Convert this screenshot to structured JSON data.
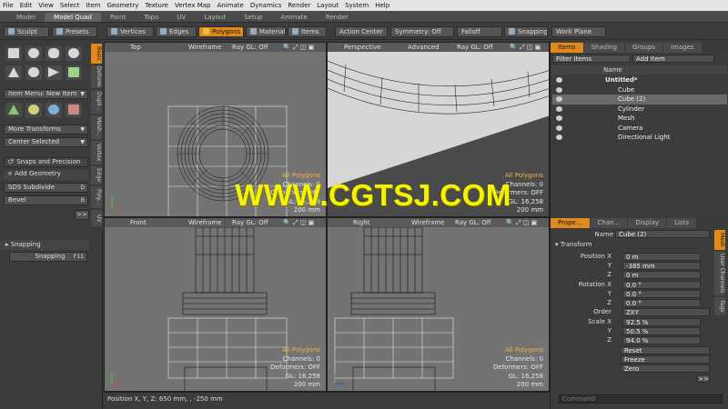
{
  "menu": [
    "File",
    "Edit",
    "View",
    "Select",
    "Item",
    "Geometry",
    "Texture",
    "Vertex Map",
    "Animate",
    "Dynamics",
    "Render",
    "Layout",
    "System",
    "Help"
  ],
  "layout_tabs": [
    {
      "label": "Model"
    },
    {
      "label": "Model Quad",
      "active": true
    },
    {
      "label": "Paint"
    },
    {
      "label": "Topo"
    },
    {
      "label": "UV"
    },
    {
      "label": "Layout"
    },
    {
      "label": "Setup"
    },
    {
      "label": "Animate"
    },
    {
      "label": "Render"
    }
  ],
  "toolbar": {
    "sculpt": "Sculpt",
    "presets": "Presets",
    "vertices": "Vertices",
    "edges": "Edges",
    "polygons": "Polygons",
    "materials": "Materials",
    "items": "Items",
    "action_center": "Action Center",
    "symmetry": "Symmetry: Off",
    "falloff": "Falloff",
    "snapping": "Snapping",
    "work_plane": "Work Plane"
  },
  "left": {
    "vtabs": [
      "Basic",
      "Deform",
      "Dupli...",
      "Mesh...",
      "Vertex",
      "Edge",
      "Poly...",
      "UV"
    ],
    "item_menu": "Item Menu: New Item",
    "more_transforms": "More Transforms",
    "center_selected": "Center Selected",
    "snaps_precision": "Snaps and Precision",
    "add_geometry": "Add Geometry",
    "sds_subdivide": "SDS Subdivide",
    "sds_key": "D",
    "bevel": "Bevel",
    "bevel_key": "B",
    "more": ">>",
    "snapping_section": "Snapping",
    "snapping_btn": "Snapping",
    "snapping_key": "F11"
  },
  "viewports": {
    "top": {
      "view": "Top",
      "shade": "Wireframe",
      "raygl": "Ray GL: Off"
    },
    "persp": {
      "view": "Perspective",
      "shade": "Advanced",
      "raygl": "Ray GL: Off"
    },
    "front": {
      "view": "Front",
      "shade": "Wireframe",
      "raygl": "Ray GL: Off"
    },
    "right": {
      "view": "Right",
      "shade": "Wireframe",
      "raygl": "Ray GL: Off"
    },
    "stats": {
      "all_polygons": "All Polygons",
      "channels": "Channels: 0",
      "deformers": "Deformers: OFF",
      "gl": "GL: 16,258",
      "size": "200 mm"
    }
  },
  "items_panel": {
    "tabs": [
      "Items",
      "Shading",
      "Groups",
      "Images"
    ],
    "filter": "Filter Items",
    "add_item": "Add Item",
    "name_header": "Name",
    "scene": "Untitled*",
    "items": [
      "Cube",
      "Cube (2)",
      "Cylinder",
      "Mesh",
      "Camera",
      "Directional Light"
    ]
  },
  "props": {
    "tabs": [
      "Prope...",
      "Chan...",
      "Display",
      "Lists"
    ],
    "side_tabs": [
      "Mesh",
      "User Channels",
      "Tags"
    ],
    "name_label": "Name",
    "name": "Cube (2)",
    "transform": "Transform",
    "position_label": "Position X",
    "position": [
      "0 m",
      "-385 mm",
      "0 m"
    ],
    "rotation_label": "Rotation X",
    "rotation": [
      "0.0 °",
      "0.0 °",
      "0.0 °"
    ],
    "order_label": "Order",
    "order": "ZXY",
    "scale_label": "Scale X",
    "scale": [
      "92.5 %",
      "50.5 %",
      "94.0 %"
    ],
    "y": "Y",
    "z": "Z",
    "reset": "Reset",
    "freeze": "Freeze",
    "zero": "Zero",
    "more": ">>",
    "command_placeholder": "Command"
  },
  "status": "Position X, Y, Z:  650 mm, , -250 mm",
  "watermark": "WWW.CGTSJ.COM"
}
